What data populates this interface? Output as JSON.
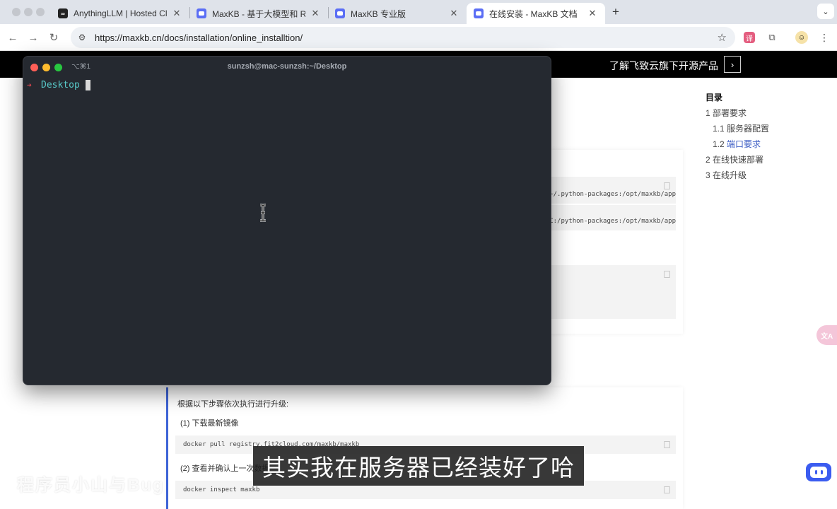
{
  "browser": {
    "tabs": [
      {
        "title": "AnythingLLM | Hosted Cloud"
      },
      {
        "title": "MaxKB - 基于大模型和 RAG 的"
      },
      {
        "title": "MaxKB 专业版"
      },
      {
        "title": "在线安装 - MaxKB 文档",
        "active": true
      }
    ],
    "url": "https://maxkb.cn/docs/installation/online_installtion/"
  },
  "page": {
    "header_promo": "了解飞致云旗下开源产品",
    "toc": {
      "title": "目录",
      "items": [
        {
          "label": "1 部署要求"
        },
        {
          "label": "1.1 服务器配置"
        },
        {
          "num": "1.2",
          "label": "端口要求"
        },
        {
          "label": "2 在线快速部署"
        },
        {
          "label": "3 在线升级"
        }
      ]
    },
    "code_fragments": [
      "~/.python-packages:/opt/maxkb/app",
      "C:/python-packages:/opt/maxkb/app"
    ],
    "upgrade": {
      "intro": "根据以下步骤依次执行进行升级:",
      "step1": "(1)  下载最新镜像",
      "cmd1": "docker pull registry.fit2cloud.com/maxkb/maxkb",
      "step2": "(2)  查看并确认上一次数据",
      "cmd2": "docker inspect maxkb"
    }
  },
  "terminal": {
    "shortcut": "⌥⌘1",
    "title": "sunzsh@mac-sunzsh:~/Desktop",
    "prompt_arrow": "➜",
    "prompt_dir": "Desktop"
  },
  "subtitle": "其实我在服务器已经装好了哈",
  "watermark": "程序员小山与Bug"
}
